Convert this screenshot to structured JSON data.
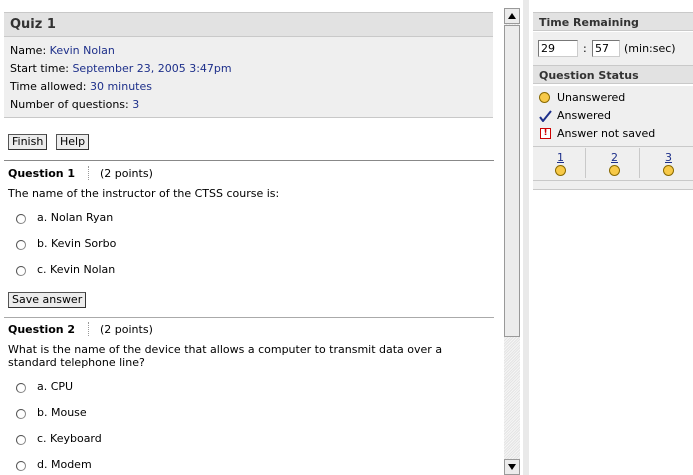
{
  "quiz": {
    "title": "Quiz 1",
    "name_label": "Name:",
    "name_value": "Kevin Nolan",
    "start_label": "Start time:",
    "start_value": "September 23, 2005 3:47pm",
    "time_label": "Time allowed:",
    "time_value": "30 minutes",
    "count_label": "Number of questions:",
    "count_value": "3"
  },
  "buttons": {
    "finish": "Finish",
    "help": "Help",
    "save_answer": "Save answer"
  },
  "questions": [
    {
      "label": "Question 1",
      "points": "(2 points)",
      "text": "The name of the instructor of the CTSS course is:",
      "options": [
        "a. Nolan Ryan",
        "b. Kevin Sorbo",
        "c. Kevin Nolan"
      ]
    },
    {
      "label": "Question 2",
      "points": "(2 points)",
      "text": "What is the name of the device that allows a computer to transmit data over a standard telephone line?",
      "options": [
        "a. CPU",
        "b. Mouse",
        "c. Keyboard",
        "d. Modem"
      ]
    }
  ],
  "timer": {
    "heading": "Time Remaining",
    "minutes": "29",
    "separator": ":",
    "seconds": "57",
    "unit": "(min:sec)"
  },
  "status": {
    "heading": "Question Status",
    "legend": {
      "unanswered": "Unanswered",
      "answered": "Answered",
      "not_saved": "Answer not saved"
    },
    "nav": [
      "1",
      "2",
      "3"
    ]
  },
  "colors": {
    "link": "#1d2f8a",
    "unanswered_dot": "#f7c948",
    "answered_check": "#1d2f8a",
    "not_saved": "#cc0000"
  },
  "icons": {
    "unanswered": "yellow-circle-icon",
    "answered": "check-icon",
    "not_saved": "exclamation-icon",
    "scroll_up": "arrow-up-icon",
    "scroll_down": "arrow-down-icon"
  }
}
